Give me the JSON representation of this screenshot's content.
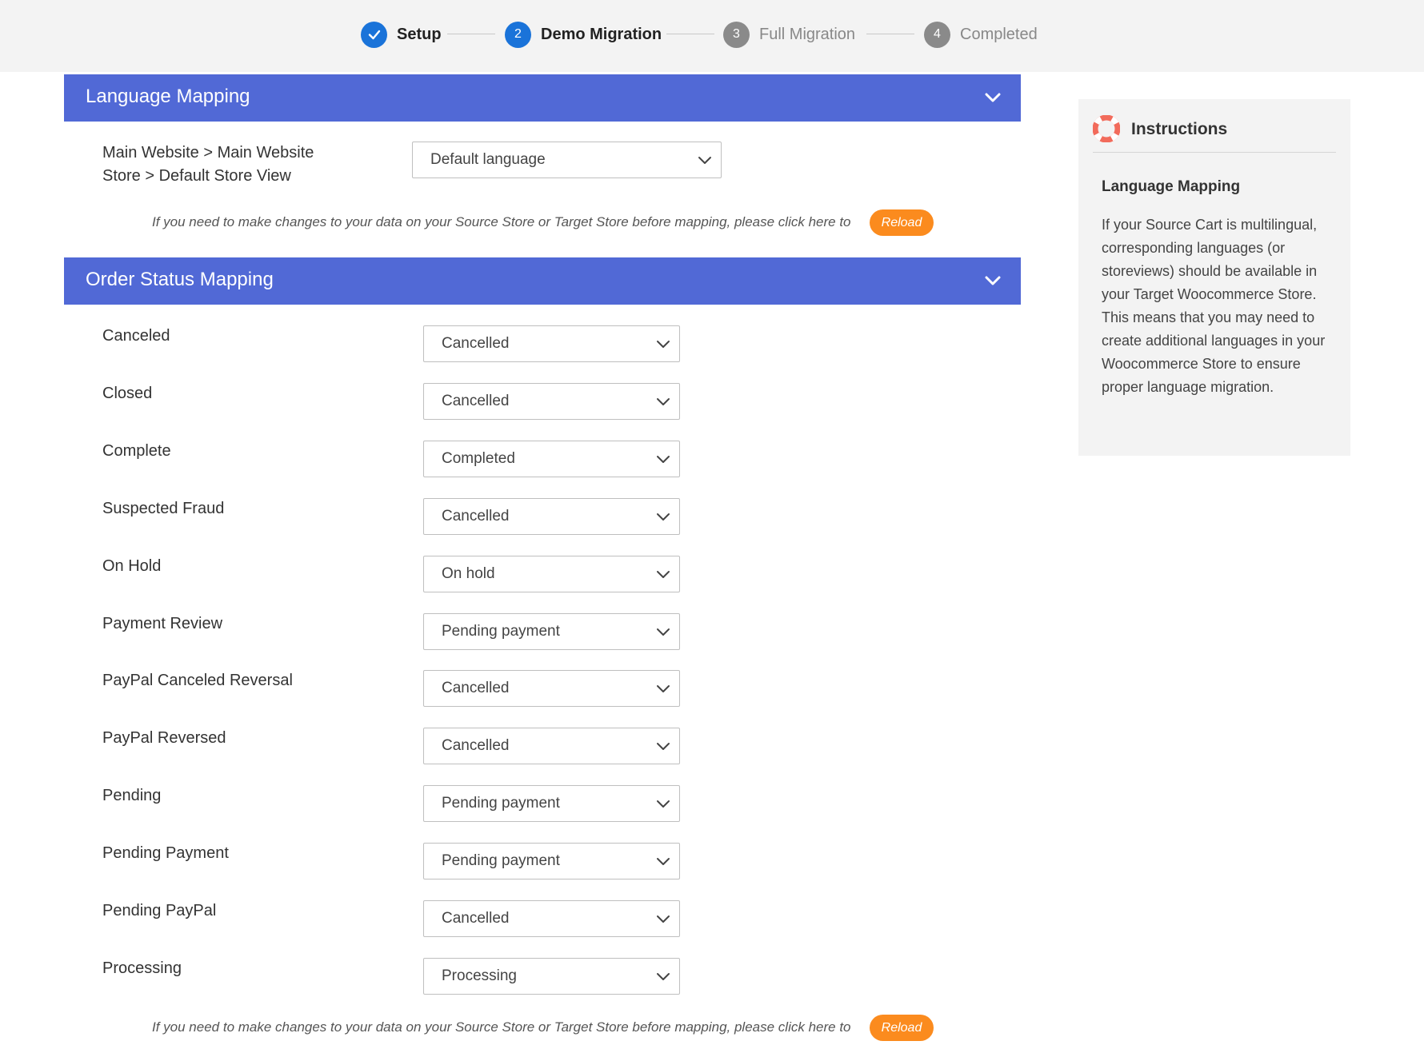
{
  "stepper": {
    "steps": [
      {
        "label": "Setup",
        "number": "",
        "state": "done"
      },
      {
        "label": "Demo Migration",
        "number": "2",
        "state": "active"
      },
      {
        "label": "Full Migration",
        "number": "3",
        "state": "inactive"
      },
      {
        "label": "Completed",
        "number": "4",
        "state": "inactive"
      }
    ]
  },
  "language_mapping": {
    "title": "Language Mapping",
    "store_label_line1": "Main Website > Main Website",
    "store_label_line2": "Store > Default Store View",
    "selected": "Default language",
    "notice": "If you need to make changes to your data on your Source Store or Target Store before mapping, please click here to",
    "reload_label": "Reload"
  },
  "order_status_mapping": {
    "title": "Order Status Mapping",
    "rows": [
      {
        "status": "Canceled",
        "mapped": "Cancelled"
      },
      {
        "status": "Closed",
        "mapped": "Cancelled"
      },
      {
        "status": "Complete",
        "mapped": "Completed"
      },
      {
        "status": "Suspected Fraud",
        "mapped": "Cancelled"
      },
      {
        "status": "On Hold",
        "mapped": "On hold"
      },
      {
        "status": "Payment Review",
        "mapped": "Pending payment"
      },
      {
        "status": "PayPal Canceled Reversal",
        "mapped": "Cancelled"
      },
      {
        "status": "PayPal Reversed",
        "mapped": "Cancelled"
      },
      {
        "status": "Pending",
        "mapped": "Pending payment"
      },
      {
        "status": "Pending Payment",
        "mapped": "Pending payment"
      },
      {
        "status": "Pending PayPal",
        "mapped": "Cancelled"
      },
      {
        "status": "Processing",
        "mapped": "Processing"
      }
    ],
    "notice": "If you need to make changes to your data on your Source Store or Target Store before mapping, please click here to",
    "reload_label": "Reload"
  },
  "instructions": {
    "title": "Instructions",
    "subtitle": "Language Mapping",
    "body": "If your Source Cart is multilingual, corresponding languages (or storeviews) should be available in your Target Woocommerce Store. This means that you may need to create additional languages in your Woocommerce Store to ensure proper language migration."
  },
  "colors": {
    "accent_blue": "#5169d6",
    "step_active": "#1a73d9",
    "reload_orange": "#fb8b1e",
    "lifebuoy_red": "#f26b5b"
  },
  "icons": {
    "check": "check-icon",
    "chevron": "chevron-down-icon",
    "instructions": "lifebuoy-icon"
  }
}
